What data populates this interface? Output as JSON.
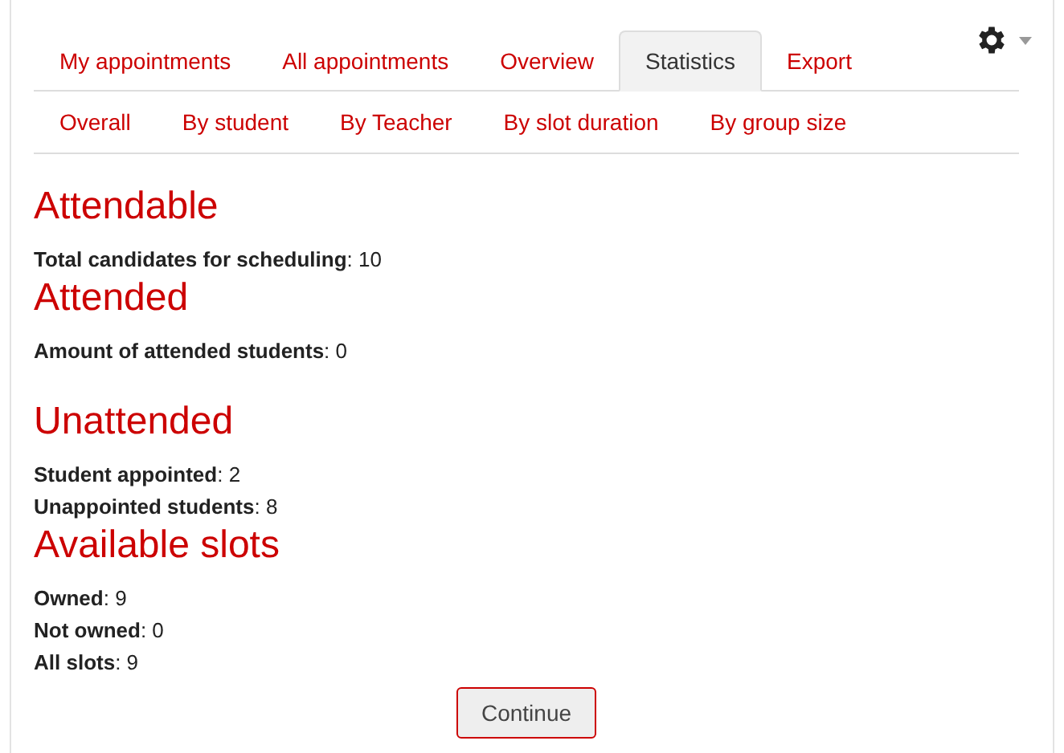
{
  "tabs": [
    {
      "label": "My appointments",
      "selected": false
    },
    {
      "label": "All appointments",
      "selected": false
    },
    {
      "label": "Overview",
      "selected": false
    },
    {
      "label": "Statistics",
      "selected": true
    },
    {
      "label": "Export",
      "selected": false
    }
  ],
  "subtabs": [
    {
      "label": "Overall"
    },
    {
      "label": "By student"
    },
    {
      "label": "By Teacher"
    },
    {
      "label": "By slot duration"
    },
    {
      "label": "By group size"
    }
  ],
  "sections": [
    {
      "heading": "Attendable",
      "stats": [
        "**Total candidates for scheduling**: 10"
      ]
    },
    {
      "heading": "Attended",
      "stats": [
        "**Amount of attended students**: 0"
      ]
    },
    {
      "heading": "Unattended",
      "stats": [
        "**Student appointed**: 2",
        "**Unappointed students**: 8"
      ]
    },
    {
      "heading": "Available slots",
      "stats": [
        "**Owned**: 9",
        "**Not owned**: 0",
        "**All slots**: 9"
      ]
    }
  ],
  "button": "Continue"
}
